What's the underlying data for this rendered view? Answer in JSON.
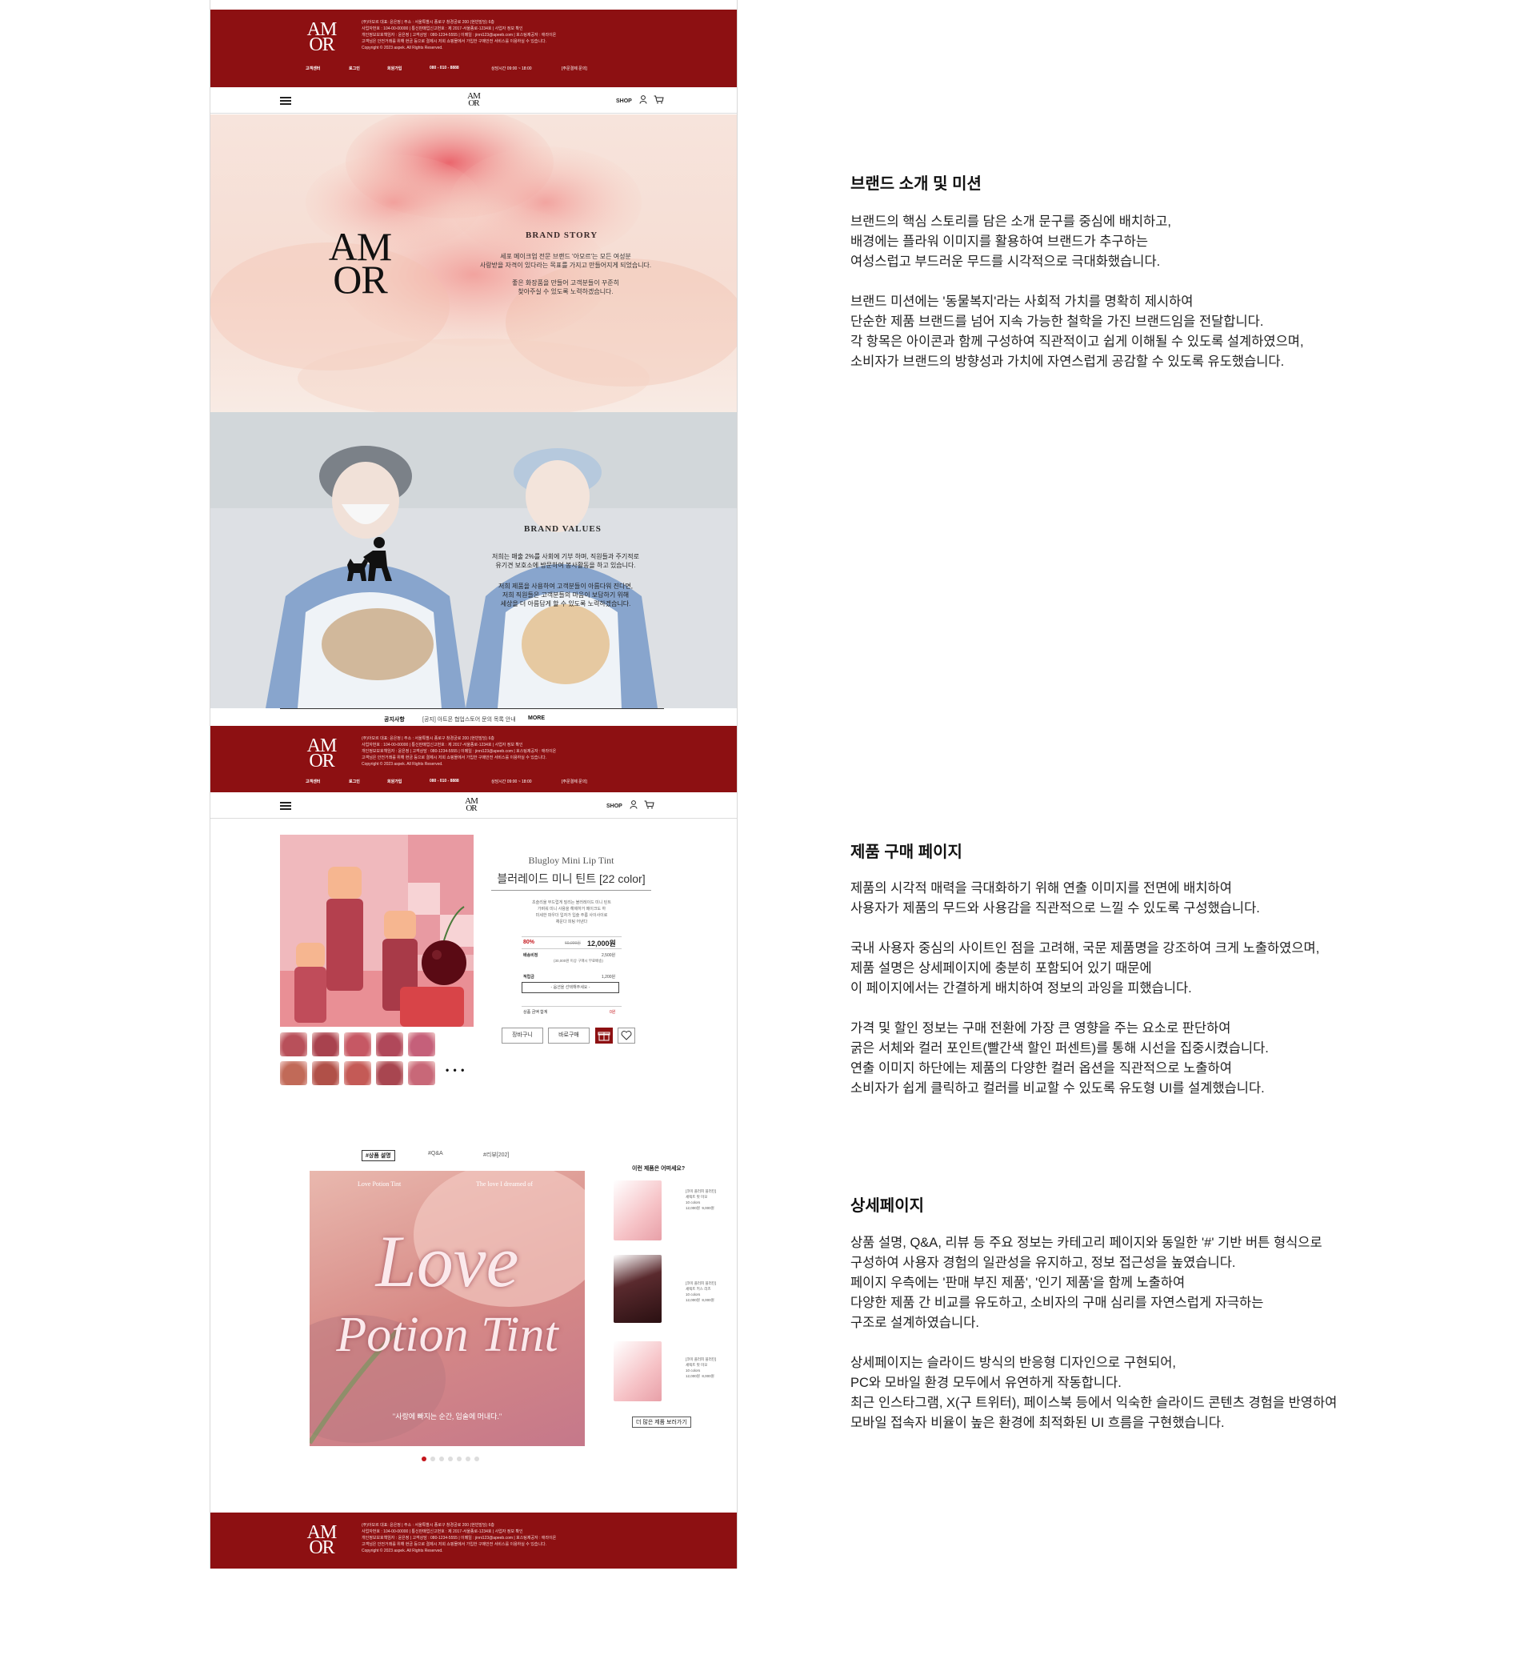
{
  "brand": {
    "logo_line1": "AM",
    "logo_line2": "OR",
    "accent": "#8d1012"
  },
  "header": {
    "shop_label": "SHOP",
    "menu_icon": "hamburger-icon",
    "user_icon": "user-icon",
    "cart_icon": "cart-icon"
  },
  "brand_story": {
    "title": "BRAND STORY",
    "body1": "세포 메이크업 전문 브랜드 '아모르'는 모든 여성분\n사랑받을 자격이 있다라는 목표를 가지고 만들어지게 되었습니다.",
    "body2": "좋은 화장품을 만들어 고객분들이 꾸준히\n찾아주실 수 있도록 노력하겠습니다."
  },
  "brand_values": {
    "title": "BRAND VALUES",
    "body1": "저희는 매출 2%를 사회에 기부 하며, 직원들과 주기적로\n유기견 보호소에 방문하여 봉사활동을 하고 있습니다.",
    "body2": "저희 제품을 사용하여 고객분들이 아름다워 진다면,\n저희 직원들은 고객분들의 마음이 보답하기 위해\n세상을 더 아름답게 할 수 있도록 노력하겠습니다."
  },
  "notice": {
    "label": "공지사항",
    "item": "[공지] 아트몬 협업스토어 문의 목록 안내",
    "more": "MORE"
  },
  "product": {
    "name_en": "Blugloy Mini Lip Tint",
    "name_ko": "블러레이드 미니 틴트 [22 color]",
    "desc": "초슬리울 부드럽게 밀리는 블러레이드 미니 틴트\n가벼워 미니 사용을 해제하거 메이크도 하\n미세한 파우더 입자가 입술 주름 사이사이로\n채운다 피팅 어낸다",
    "discount": "80%",
    "original_price": "60,000원",
    "price": "12,000원",
    "shipping_label": "배송비정",
    "shipping_value": "2,500원",
    "shipping_note": "(30,000원 이상 구매시 무료배송)",
    "points_label": "적립금",
    "points_value": "1,200원",
    "option_placeholder": "- 옵션을 선택해주세요 -",
    "total_label": "상품 금액 합계",
    "total_value": "0원",
    "cart_btn": "장바구니",
    "buy_btn": "바로구매",
    "more_dots": "• • •",
    "swatch_colors": [
      "#b8505a",
      "#a8424e",
      "#c65864",
      "#b0485a",
      "#c5607a",
      "#c16a58",
      "#b05048",
      "#c45a56",
      "#a84650",
      "#c86878"
    ]
  },
  "detail": {
    "tabs": [
      "#상품 설명",
      "#Q&A",
      "#리뷰[202]"
    ],
    "banner_top_left": "Love Potion Tint",
    "banner_top_right": "The love I dreamed of",
    "banner_script1": "Love",
    "banner_script2": "Potion Tint",
    "banner_quote": "\"사랑에 빠지는 순간, 입술에 머내다.\"",
    "rec_title": "이런 제품은 어떠세요?",
    "rec_items": [
      "[코미 플러피 블러틴]\n세렉트 핏 미모\n10 colors\n12,000원  9,000원",
      "[코미 플러피 블러틴]\n세렉트 키스 리즈\n10 colors\n12,000원  8,000원",
      "[코미 플러피 블러틴]\n세렉트 핏 미모\n10 colors\n12,000원  8,000원"
    ],
    "rec_more": "더 많은 제품 보러가기"
  },
  "footer": {
    "lines": [
      "(주)아모르 대표: 윤은정   | 주소 : 서울특별시 종로구 창경궁로 200 (현빈빌딩) 6층",
      "사업자번호 : 104-00-00000   | 통신판매업신고번호 : 제 2017-서울종로-1234호   | 사업자 정보 확인",
      "개인정보보호책임자 : 윤은정   | 고객상담 : 080-1234-5555   | 이메일 : jinni123@apeeb.com   | 호스팅제공자 : 애라이온",
      "고객님은 안전거래를 위해 현금 등으로 결제시 저희 쇼핑몰에서 가입한 구매안전 서비스를 이용하실 수 있습니다.",
      "Copyright © 2023 aspek. All Rights Reserved."
    ],
    "bar": [
      "고객센터",
      "로그인",
      "회원가입",
      "080 - 010 - 8888",
      "상담시간 09:00 ~ 18:00",
      "[주문결제 문의]"
    ]
  },
  "sections": [
    {
      "heading": "브랜드 소개 및 미션",
      "body": "브랜드의 핵심 스토리를 담은 소개 문구를 중심에 배치하고,\n배경에는 플라워 이미지를 활용하여 브랜드가 추구하는\n여성스럽고 부드러운 무드를 시각적으로 극대화했습니다.\n\n브랜드 미션에는 '동물복지'라는 사회적 가치를 명확히 제시하여\n단순한 제품 브랜드를 넘어 지속 가능한 철학을 가진 브랜드임을 전달합니다.\n각 항목은 아이콘과 함께 구성하여 직관적이고 쉽게 이해될 수 있도록 설계하였으며,\n소비자가 브랜드의 방향성과 가치에 자연스럽게 공감할 수 있도록 유도했습니다."
    },
    {
      "heading": "제품 구매 페이지",
      "body": "제품의 시각적 매력을 극대화하기 위해 연출 이미지를 전면에 배치하여\n사용자가 제품의 무드와 사용감을 직관적으로 느낄 수 있도록 구성했습니다.\n\n국내 사용자 중심의 사이트인 점을 고려해, 국문 제품명을 강조하여 크게 노출하였으며,\n제품 설명은 상세페이지에 충분히 포함되어 있기 때문에\n이 페이지에서는 간결하게 배치하여 정보의 과잉을 피했습니다.\n\n가격 및 할인 정보는 구매 전환에 가장 큰 영향을 주는 요소로 판단하여\n굵은 서체와 컬러 포인트(빨간색 할인 퍼센트)를 통해 시선을 집중시켰습니다.\n연출 이미지 하단에는 제품의 다양한 컬러 옵션을 직관적으로 노출하여\n소비자가 쉽게 클릭하고 컬러를 비교할 수 있도록 유도형 UI를 설계했습니다."
    },
    {
      "heading": "상세페이지",
      "body": "상품 설명, Q&A, 리뷰 등 주요 정보는 카테고리 페이지와 동일한 '#' 기반 버튼 형식으로\n구성하여 사용자 경험의 일관성을 유지하고, 정보 접근성을 높였습니다.\n페이지 우측에는 '판매 부진 제품', '인기 제품'을 함께 노출하여\n다양한 제품 간 비교를 유도하고, 소비자의 구매 심리를 자연스럽게 자극하는\n구조로 설계하였습니다.\n\n상세페이지는 슬라이드 방식의 반응형 디자인으로 구현되어,\nPC와 모바일 환경 모두에서 유연하게 작동합니다.\n최근 인스타그램, X(구 트위터), 페이스북 등에서 익숙한 슬라이드 콘텐츠 경험을 반영하여\n모바일 접속자 비율이 높은 환경에 최적화된 UI 흐름을 구현했습니다."
    }
  ]
}
